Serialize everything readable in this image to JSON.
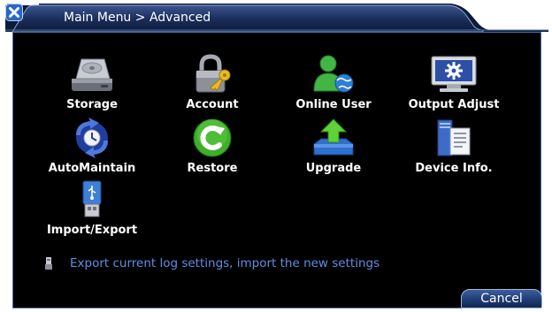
{
  "title": {
    "text": "Main Menu > Advanced",
    "icon": "menu-icon",
    "close_icon": "close-icon"
  },
  "menu_items": [
    {
      "label": "Storage",
      "icon": "hard-disk-icon"
    },
    {
      "label": "Account",
      "icon": "padlock-key-icon"
    },
    {
      "label": "Online User",
      "icon": "online-user-icon"
    },
    {
      "label": "Output Adjust",
      "icon": "monitor-gear-icon"
    },
    {
      "label": "AutoMaintain",
      "icon": "auto-maintain-icon"
    },
    {
      "label": "Restore",
      "icon": "restore-icon"
    },
    {
      "label": "Upgrade",
      "icon": "upgrade-icon"
    },
    {
      "label": "Device Info.",
      "icon": "device-info-icon"
    },
    {
      "label": "Import/Export",
      "icon": "usb-drive-icon"
    }
  ],
  "hint": {
    "icon": "usb-small-icon",
    "text": "Export current log settings, import the new settings"
  },
  "buttons": {
    "cancel": "Cancel"
  },
  "colors": {
    "titlebar": "#1c2f5c",
    "border": "#4b6fa8",
    "background": "#000000",
    "hint_text": "#5f8fe3",
    "title_icon": "#e0263b"
  }
}
